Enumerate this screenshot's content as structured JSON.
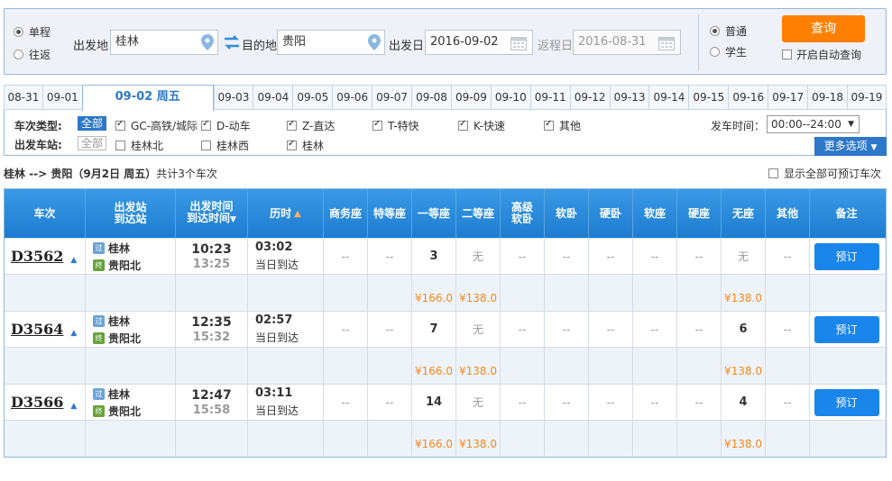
{
  "search": {
    "trip_types": [
      {
        "label": "单程",
        "selected": true
      },
      {
        "label": "往返",
        "selected": false
      }
    ],
    "from_label": "出发地",
    "from_value": "桂林",
    "to_label": "目的地",
    "to_value": "贵阳",
    "depart_date_label": "出发日",
    "depart_date_value": "2016-09-02",
    "return_date_label": "返程日",
    "return_date_value": "2016-08-31",
    "passenger_types": [
      {
        "label": "普通",
        "selected": true
      },
      {
        "label": "学生",
        "selected": false
      }
    ],
    "query_label": "查询",
    "auto_query_label": "开启自动查询"
  },
  "date_tabs": [
    {
      "label": "08-31",
      "active": false
    },
    {
      "label": "09-01",
      "active": false
    },
    {
      "label": "09-02 周五",
      "active": true
    },
    {
      "label": "09-03",
      "active": false
    },
    {
      "label": "09-04",
      "active": false
    },
    {
      "label": "09-05",
      "active": false
    },
    {
      "label": "09-06",
      "active": false
    },
    {
      "label": "09-07",
      "active": false
    },
    {
      "label": "09-08",
      "active": false
    },
    {
      "label": "09-09",
      "active": false
    },
    {
      "label": "09-10",
      "active": false
    },
    {
      "label": "09-11",
      "active": false
    },
    {
      "label": "09-12",
      "active": false
    },
    {
      "label": "09-13",
      "active": false
    },
    {
      "label": "09-14",
      "active": false
    },
    {
      "label": "09-15",
      "active": false
    },
    {
      "label": "09-16",
      "active": false
    },
    {
      "label": "09-17",
      "active": false
    },
    {
      "label": "09-18",
      "active": false
    },
    {
      "label": "09-19",
      "active": false
    }
  ],
  "filters": {
    "type_label": "车次类型:",
    "type_all": "全部",
    "types": [
      {
        "label": "GC-高铁/城际",
        "checked": true
      },
      {
        "label": "D-动车",
        "checked": true
      },
      {
        "label": "Z-直达",
        "checked": true
      },
      {
        "label": "T-特快",
        "checked": true
      },
      {
        "label": "K-快速",
        "checked": true
      },
      {
        "label": "其他",
        "checked": true
      }
    ],
    "station_label": "出发车站:",
    "station_all": "全部",
    "stations": [
      {
        "label": "桂林北",
        "checked": false
      },
      {
        "label": "桂林西",
        "checked": false
      },
      {
        "label": "桂林",
        "checked": true
      }
    ],
    "time_label": "发车时间：",
    "time_value": "00:00--24:00",
    "more_label": "更多选项"
  },
  "summary": {
    "route": "桂林 --> 贵阳（9月2日  周五）",
    "count_text": "共计3个车次",
    "show_all_label": "显示全部可预订车次"
  },
  "table": {
    "headers": {
      "train": "车次",
      "station_1": "出发站",
      "station_2": "到达站",
      "time_1": "出发时间",
      "time_2": "到达时间",
      "duration": "历时",
      "business": "商务座",
      "special": "特等座",
      "first": "一等座",
      "second": "二等座",
      "premium_1": "高级",
      "premium_2": "软卧",
      "soft_sleeper": "软卧",
      "hard_sleeper": "硬卧",
      "soft_seat": "软座",
      "hard_seat": "硬座",
      "no_seat": "无座",
      "other": "其他",
      "note": "备注"
    },
    "trains": [
      {
        "no": "D3562",
        "from_badge": "过",
        "from": "桂林",
        "to_badge": "终",
        "to": "贵阳北",
        "dep": "10:23",
        "arr": "13:25",
        "duration": "03:02",
        "arrive_day": "当日到达",
        "seats": [
          "--",
          "--",
          "3",
          "无",
          "--",
          "--",
          "--",
          "--",
          "--",
          "无",
          "--"
        ],
        "prices": [
          "",
          "",
          "¥166.0",
          "¥138.0",
          "",
          "",
          "",
          "",
          "",
          "¥138.0",
          ""
        ],
        "book_label": "预订"
      },
      {
        "no": "D3564",
        "from_badge": "过",
        "from": "桂林",
        "to_badge": "终",
        "to": "贵阳北",
        "dep": "12:35",
        "arr": "15:32",
        "duration": "02:57",
        "arrive_day": "当日到达",
        "seats": [
          "--",
          "--",
          "7",
          "无",
          "--",
          "--",
          "--",
          "--",
          "--",
          "6",
          "--"
        ],
        "prices": [
          "",
          "",
          "¥166.0",
          "¥138.0",
          "",
          "",
          "",
          "",
          "",
          "¥138.0",
          ""
        ],
        "book_label": "预订"
      },
      {
        "no": "D3566",
        "from_badge": "过",
        "from": "桂林",
        "to_badge": "终",
        "to": "贵阳北",
        "dep": "12:47",
        "arr": "15:58",
        "duration": "03:11",
        "arrive_day": "当日到达",
        "seats": [
          "--",
          "--",
          "14",
          "无",
          "--",
          "--",
          "--",
          "--",
          "--",
          "4",
          "--"
        ],
        "prices": [
          "",
          "",
          "¥166.0",
          "¥138.0",
          "",
          "",
          "",
          "",
          "",
          "¥138.0",
          ""
        ],
        "book_label": "预订"
      }
    ]
  },
  "colors": {
    "accent": "#2d78c8",
    "query_button": "#ff8000",
    "price": "#f28a1e",
    "header_blue": "#1d7cd0"
  }
}
